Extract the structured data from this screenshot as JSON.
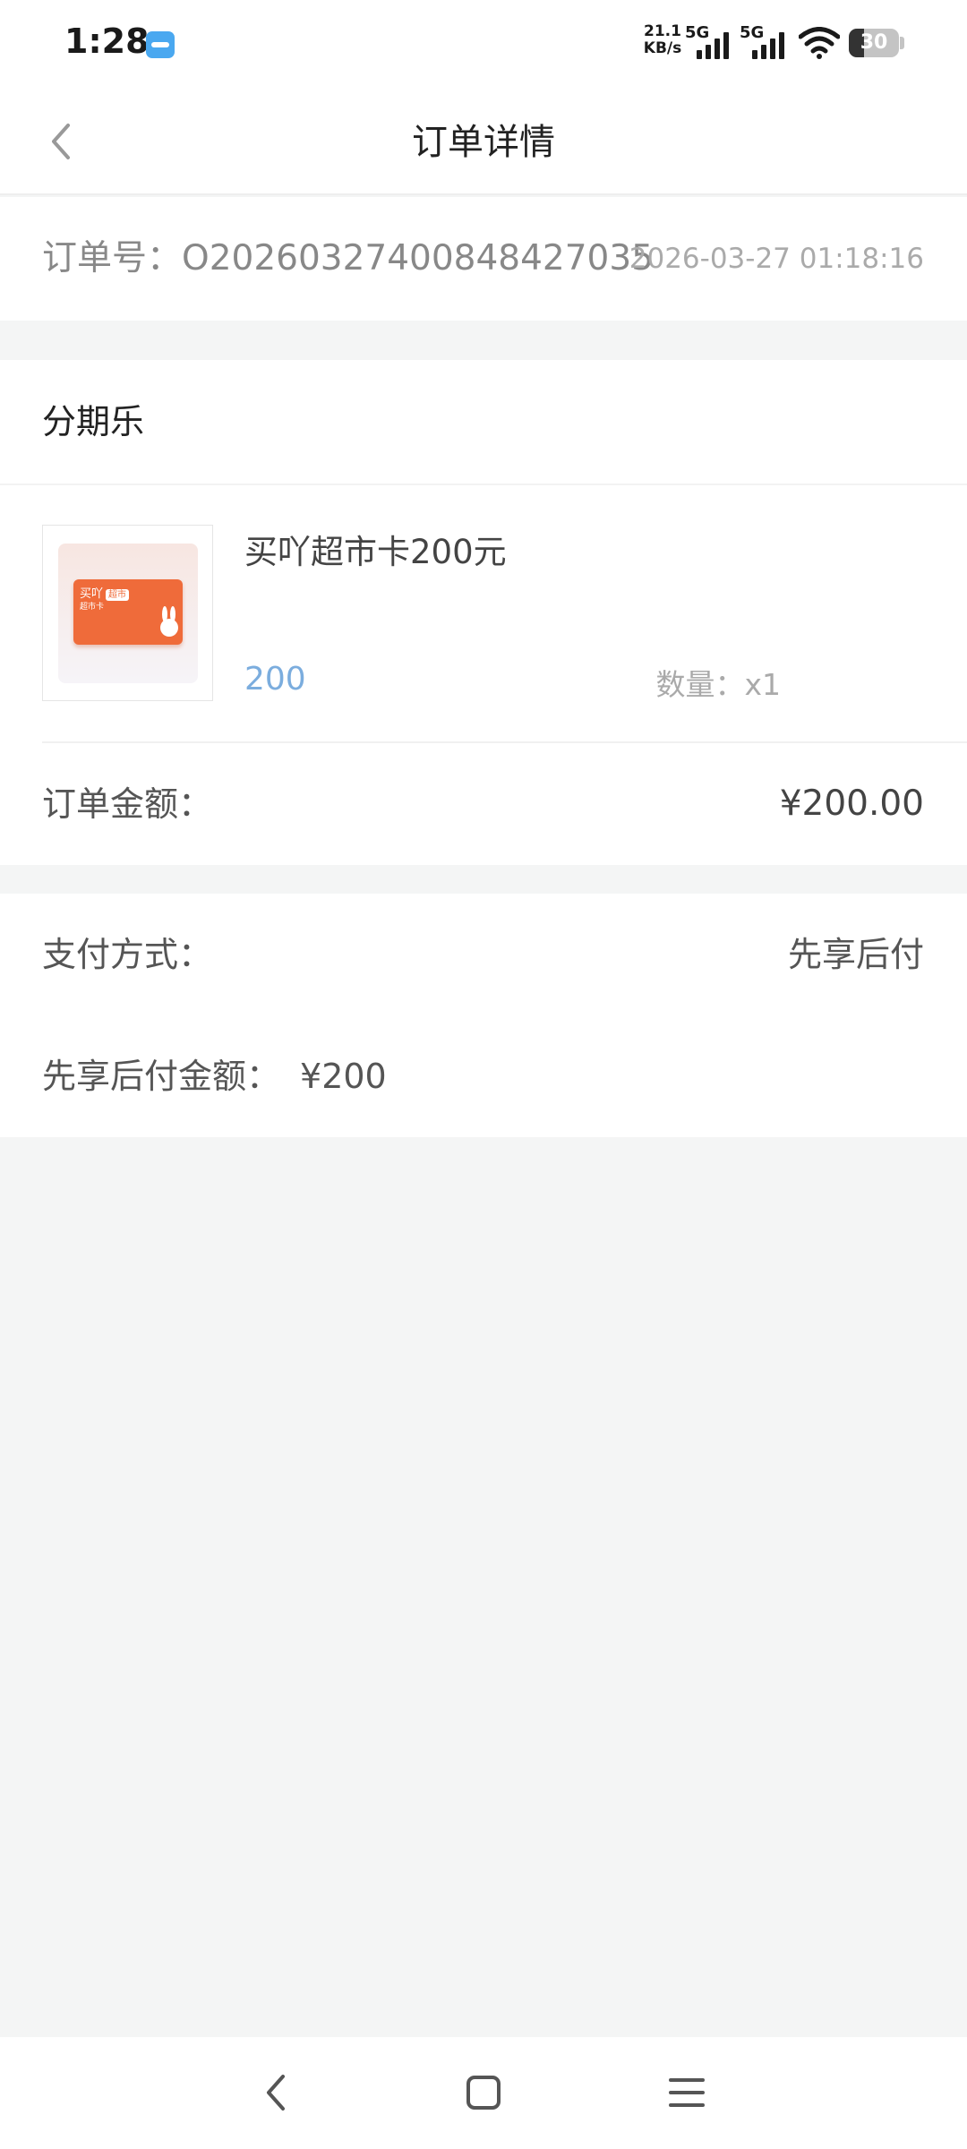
{
  "status_bar": {
    "time": "1:28",
    "app_badge_icon": "app-notification-icon",
    "net_speed_value": "21.1",
    "net_speed_unit": "KB/s",
    "sim1_label": "5G",
    "sim2_label": "5G",
    "battery_level": "30",
    "battery_fraction": 0.3
  },
  "header": {
    "title": "订单详情",
    "back_icon": "chevron-left-icon"
  },
  "order": {
    "number": "订单号：O20260327400848427035",
    "time": "2026-03-27 01:18:16"
  },
  "product": {
    "store_name": "分期乐",
    "name": "买吖超市卡200元",
    "price": "200",
    "quantity": "数量：x1",
    "card_brand": "买吖",
    "card_tag": "超市",
    "card_sub": "超市卡",
    "amount_label": "订单金额：",
    "amount_value": "¥200.00"
  },
  "payment": {
    "method_label": "支付方式：",
    "method_value": "先享后付",
    "bnpl_label": "先享后付金额：",
    "bnpl_value": "¥200"
  },
  "system_nav": {
    "back_icon": "back-triangle-icon",
    "home_icon": "home-square-icon",
    "menu_icon": "menu-lines-icon"
  },
  "colors": {
    "page_bg": "#f4f5f5",
    "price_blue": "#7badde",
    "card_orange": "#ef6b3a"
  }
}
